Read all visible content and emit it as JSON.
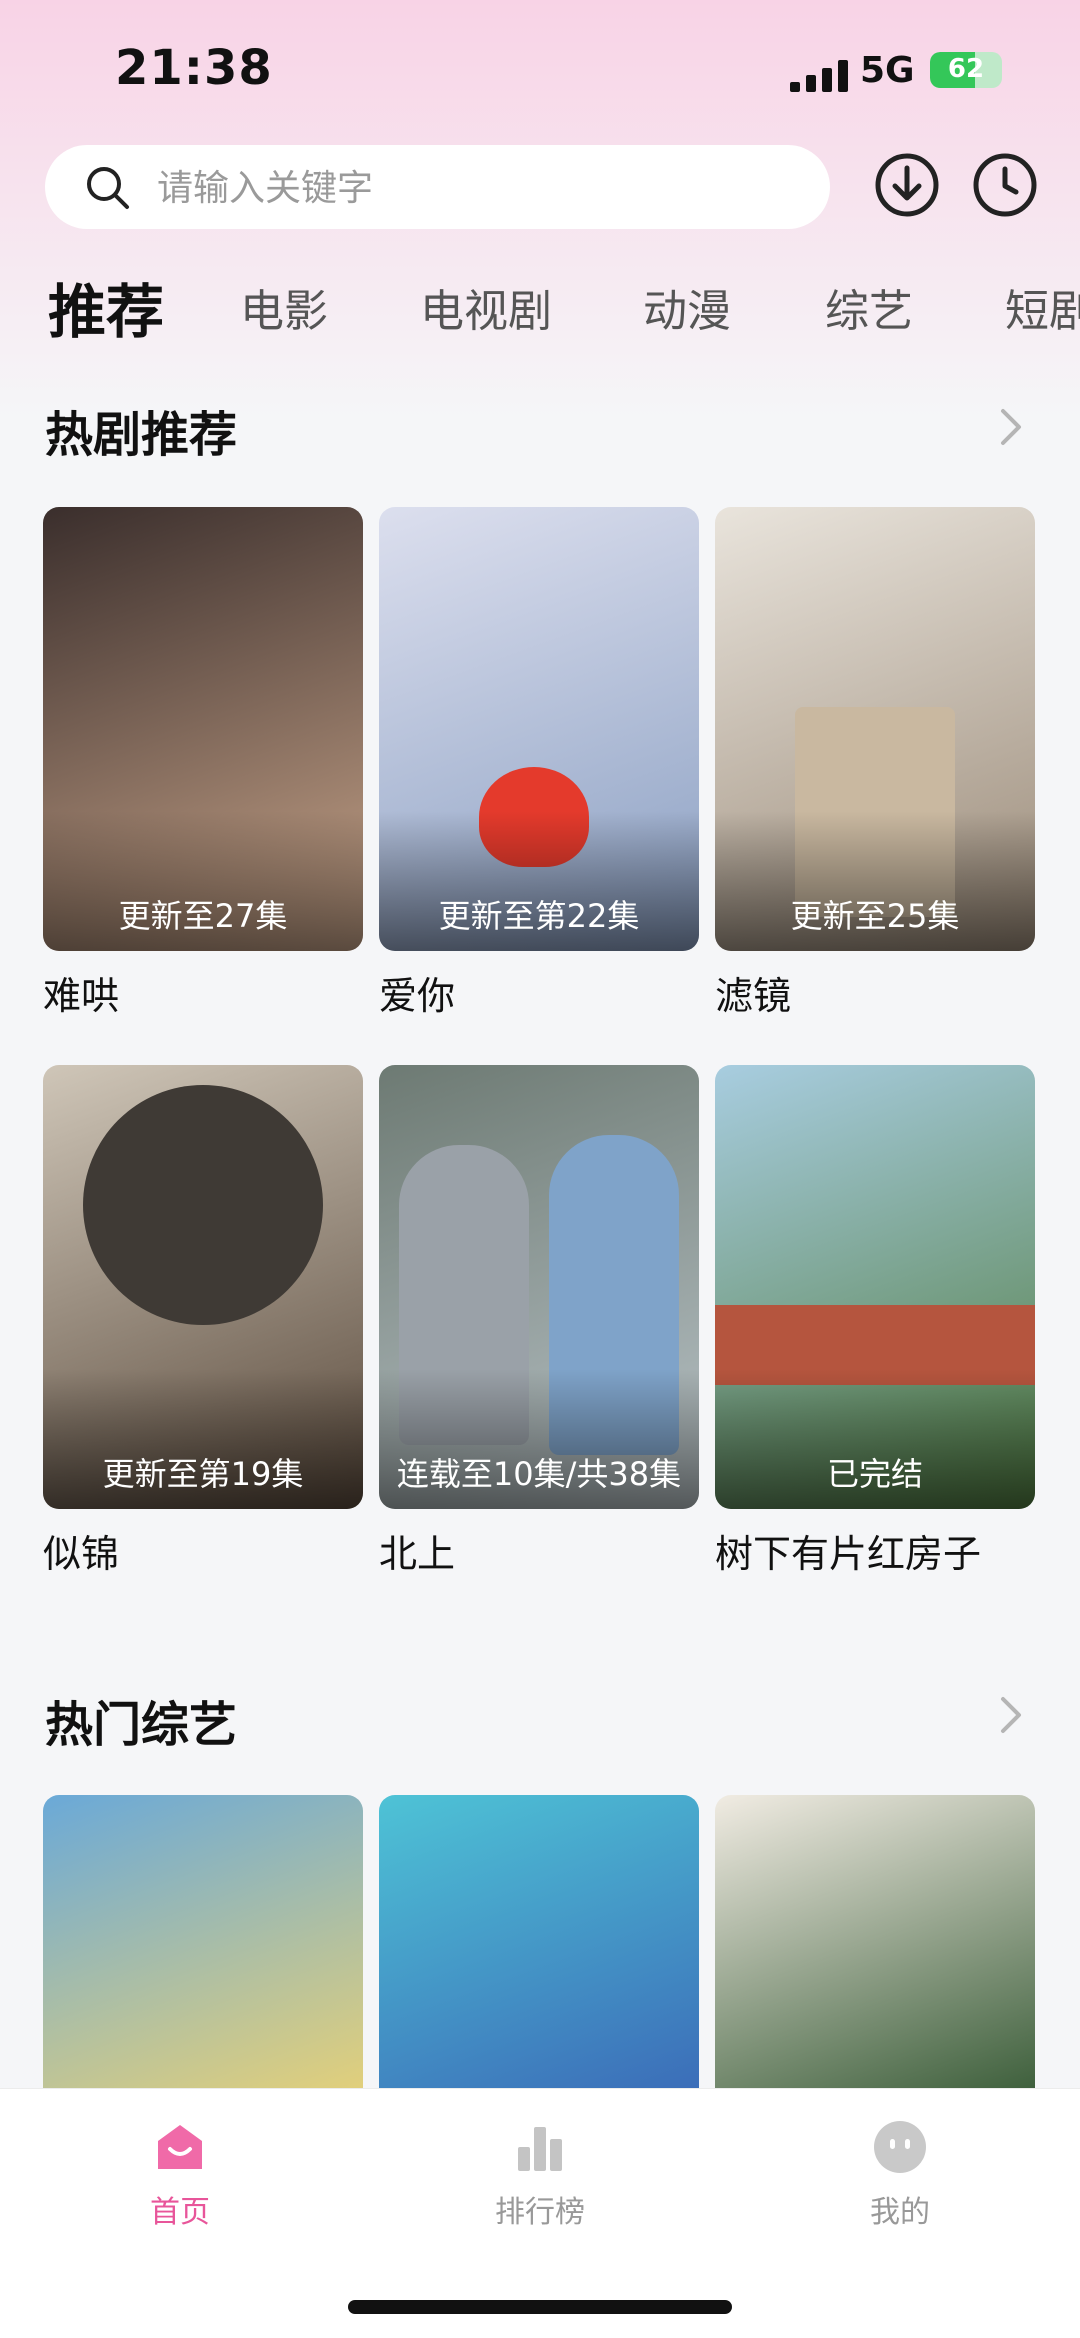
{
  "status_bar": {
    "time": "21:38",
    "network": "5G",
    "battery": "62",
    "battery_level": 0.62
  },
  "search": {
    "placeholder": "请输入关键字",
    "icon": "search-icon"
  },
  "header_actions": {
    "download_icon": "download-icon",
    "history_icon": "history-clock-icon"
  },
  "tabs": [
    {
      "label": "推荐",
      "active": true
    },
    {
      "label": "电影"
    },
    {
      "label": "电视剧"
    },
    {
      "label": "动漫"
    },
    {
      "label": "综艺"
    },
    {
      "label": "短剧"
    }
  ],
  "hot_dramas": {
    "title": "热剧推荐",
    "items": [
      {
        "title": "难哄",
        "badge": "更新至27集",
        "color_a": "#3a2e2c",
        "color_b": "#c9a58a"
      },
      {
        "title": "爱你",
        "badge": "更新至第22集",
        "color_a": "#dcdfee",
        "color_b": "#8a9fc2"
      },
      {
        "title": "滤镜",
        "badge": "更新至25集",
        "color_a": "#e9e4dc",
        "color_b": "#9a8a78"
      },
      {
        "title": "似锦",
        "badge": "更新至第19集",
        "color_a": "#cfc6b8",
        "color_b": "#5a4a3c"
      },
      {
        "title": "北上",
        "badge": "连载至10集/共38集",
        "color_a": "#6d7a73",
        "color_b": "#b9c3c7"
      },
      {
        "title": "树下有片红房子",
        "badge": "已完结",
        "color_a": "#a8cde0",
        "color_b": "#4f7a3f"
      }
    ]
  },
  "hot_variety": {
    "title": "热门综艺",
    "items": [
      {
        "color_a": "#6aa9d8",
        "color_b": "#e3d07a"
      },
      {
        "color_a": "#4ec3d6",
        "color_b": "#3b6cb8"
      },
      {
        "color_a": "#f1ece3",
        "color_b": "#3c5e3a"
      }
    ]
  },
  "bottom_nav": [
    {
      "label": "首页",
      "icon": "home-icon",
      "active": true
    },
    {
      "label": "排行榜",
      "icon": "ranking-chart-icon"
    },
    {
      "label": "我的",
      "icon": "profile-face-icon"
    }
  ],
  "colors": {
    "accent": "#e8559a",
    "inactive": "#b8b8b8"
  }
}
